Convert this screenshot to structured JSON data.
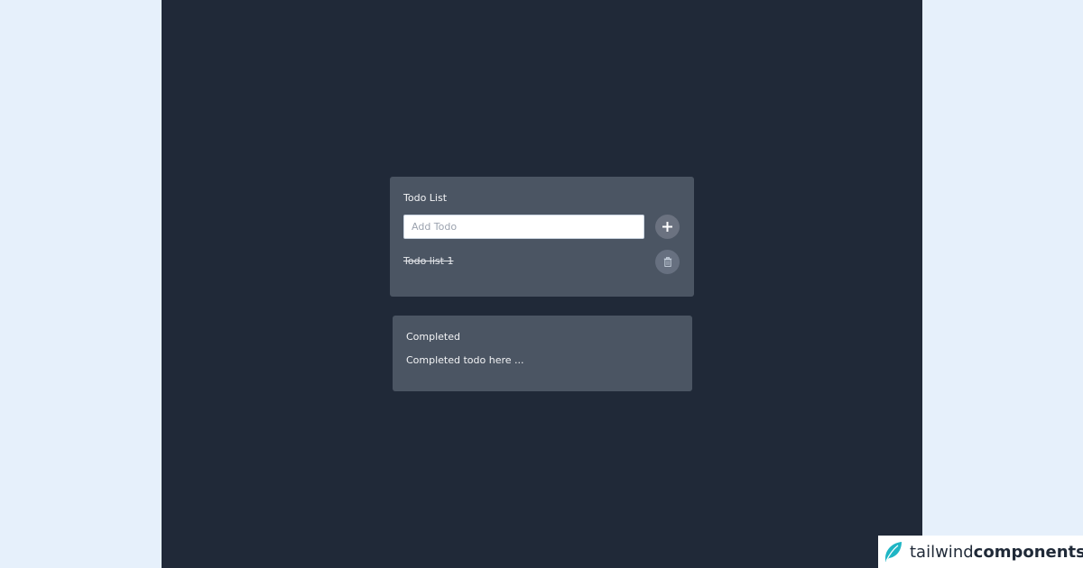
{
  "todo": {
    "title": "Todo List",
    "input_placeholder": "Add Todo",
    "input_value": "",
    "add_icon": "plus-icon",
    "items": [
      {
        "label": "Todo list 1",
        "completed": true,
        "delete_icon": "trash-icon"
      }
    ]
  },
  "completed": {
    "title": "Completed",
    "empty_text": "Completed todo here ..."
  },
  "brand": {
    "part1": "tailwind",
    "part2": "components",
    "logo_icon": "feather-leaf-icon"
  },
  "colors": {
    "page_bg": "#e6f0fb",
    "frame_bg": "#202938",
    "card_bg": "#4b5563",
    "button_bg": "#6b7280",
    "brand_accent": "#1fb6c5"
  }
}
